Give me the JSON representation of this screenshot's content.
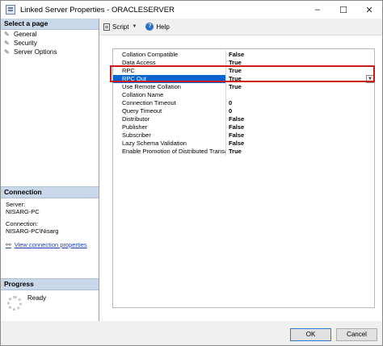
{
  "window": {
    "title": "Linked Server Properties - ORACLESERVER",
    "minimize": "–",
    "maximize": "☐",
    "close": "✕"
  },
  "select_page": {
    "heading": "Select a page",
    "items": [
      {
        "label": "General",
        "icon": "wrench-icon"
      },
      {
        "label": "Security",
        "icon": "wrench-icon"
      },
      {
        "label": "Server Options",
        "icon": "wrench-icon"
      }
    ]
  },
  "connection": {
    "heading": "Connection",
    "server_label": "Server:",
    "server_value": "NISARG-PC",
    "connection_label": "Connection:",
    "connection_value": "NISARG-PC\\Nisarg",
    "view_link": "View connection properties"
  },
  "progress": {
    "heading": "Progress",
    "status": "Ready"
  },
  "toolbar": {
    "script_label": "Script",
    "help_label": "Help"
  },
  "options": [
    {
      "name": "Collation Compatible",
      "value": "False"
    },
    {
      "name": "Data Access",
      "value": "True"
    },
    {
      "name": "RPC",
      "value": "True"
    },
    {
      "name": "RPC Out",
      "value": "True"
    },
    {
      "name": "Use Remote Collation",
      "value": "True"
    },
    {
      "name": "Collation Name",
      "value": ""
    },
    {
      "name": "Connection Timeout",
      "value": "0"
    },
    {
      "name": "Query Timeout",
      "value": "0"
    },
    {
      "name": "Distributor",
      "value": "False"
    },
    {
      "name": "Publisher",
      "value": "False"
    },
    {
      "name": "Subscriber",
      "value": "False"
    },
    {
      "name": "Lazy Schema Validation",
      "value": "False"
    },
    {
      "name": "Enable Promotion of Distributed Transaction",
      "value": "True"
    }
  ],
  "selected_option": "RPC Out",
  "footer": {
    "ok_label": "OK",
    "cancel_label": "Cancel"
  },
  "colors": {
    "selection": "#0a64d0",
    "highlight_box": "#cc1b1b"
  }
}
